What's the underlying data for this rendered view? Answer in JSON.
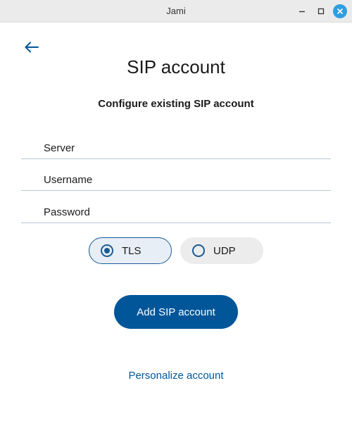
{
  "window": {
    "title": "Jami"
  },
  "header": {
    "back_icon": "arrow-left-icon",
    "title": "SIP account",
    "subtitle": "Configure existing SIP account"
  },
  "form": {
    "server": {
      "placeholder": "Server",
      "value": ""
    },
    "username": {
      "placeholder": "Username",
      "value": ""
    },
    "password": {
      "placeholder": "Password",
      "value": ""
    }
  },
  "transport": {
    "options": [
      {
        "label": "TLS",
        "selected": true
      },
      {
        "label": "UDP",
        "selected": false
      }
    ]
  },
  "actions": {
    "add_label": "Add SIP account",
    "personalize_label": "Personalize account"
  },
  "colors": {
    "accent": "#005699",
    "title_bar": "#ebebeb",
    "close_button": "#2f9ee0",
    "field_underline": "#b9c7d3"
  }
}
